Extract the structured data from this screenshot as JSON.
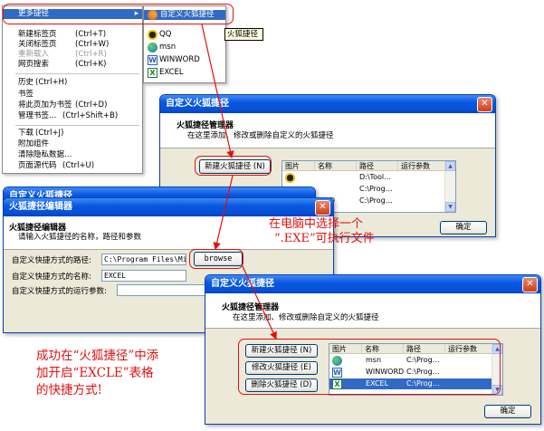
{
  "context_menu": {
    "items": [
      {
        "label": "更多捷径",
        "shortcut": "",
        "state": "highlighted"
      },
      {
        "label": "新建标签页",
        "shortcut": "(Ctrl+T)",
        "state": "normal"
      },
      {
        "label": "关闭标签页",
        "shortcut": "(Ctrl+W)",
        "state": "normal"
      },
      {
        "label": "重新载入",
        "shortcut": "(Ctrl+R)",
        "state": "disabled"
      },
      {
        "label": "网页搜索",
        "shortcut": "(Ctrl+K)",
        "state": "normal"
      },
      {
        "label": "历史",
        "shortcut": "(Ctrl+H)",
        "state": "normal"
      },
      {
        "label": "书签",
        "shortcut": "",
        "state": "normal"
      },
      {
        "label": "将此页加为书签",
        "shortcut": "(Ctrl+D)",
        "state": "normal"
      },
      {
        "label": "管理书签…",
        "shortcut": "(Ctrl+Shift+B)",
        "state": "normal"
      },
      {
        "label": "下载",
        "shortcut": "(Ctrl+J)",
        "state": "normal"
      },
      {
        "label": "附加组件",
        "shortcut": "",
        "state": "normal"
      },
      {
        "label": "清除隐私数据…",
        "shortcut": "",
        "state": "normal"
      },
      {
        "label": "页面源代码",
        "shortcut": "(Ctrl+U)",
        "state": "normal"
      }
    ]
  },
  "submenu": {
    "items": [
      "自定义火狐捷径",
      "QQ",
      "msn",
      "WINWORD",
      "EXCEL"
    ]
  },
  "tooltip": "火狐捷径",
  "manager_window_1": {
    "title": "自定义火狐捷径",
    "header_title": "火狐捷径管理器",
    "header_desc": "在这里添加、修改或删除自定义的火狐捷径",
    "new_button": "新建火狐捷径 (N)",
    "columns": [
      "图片",
      "名称",
      "路径",
      "运行参数"
    ],
    "rows": [
      {
        "name": "",
        "path": "D:\\Tool…"
      },
      {
        "name": "",
        "path": "C:\\Prog…"
      },
      {
        "name": "ORD",
        "path": "C:\\Prog…"
      }
    ],
    "ok_button": "确定"
  },
  "editor_window": {
    "title_behind": "自定义火狐捷径",
    "title": "火狐捷径编辑器",
    "header_title": "火狐捷径编辑器",
    "header_desc": "请输入火狐捷径的名称，路径和参数",
    "path_label": "自定义快捷方式的路径:",
    "path_value": "C:\\Program Files\\Micr",
    "browse_button": "browse",
    "name_label": "自定义快捷方式的名称:",
    "name_value": "EXCEL",
    "args_label": "自定义快捷方式的运行参数:",
    "args_value": ""
  },
  "manager_window_2": {
    "title": "自定义火狐捷径",
    "header_title": "火狐捷径管理器",
    "header_desc": "在这里添加、修改或删除自定义的火狐捷径",
    "new_button": "新建火狐捷径 (N)",
    "edit_button": "修改火狐捷径 (E)",
    "delete_button": "删除火狐捷径 (D)",
    "columns": [
      "图片",
      "名称",
      "路径",
      "运行参数"
    ],
    "rows": [
      {
        "name": "msn",
        "path": "C:\\Prog…"
      },
      {
        "name": "WINWORD",
        "path": "C:\\Prog…"
      },
      {
        "name": "EXCEL",
        "path": "C:\\Prog…"
      }
    ],
    "ok_button": "确定"
  },
  "annotations": {
    "choose_exe_line1": "在电脑中选择一个",
    "choose_exe_line2": "“.EXE”可执行文件",
    "success_line1": "成功在“火狐捷径”中添",
    "success_line2": "加开启“EXCLE”表格",
    "success_line3": "的快捷方式!"
  },
  "colors": {
    "annotation_red": "#e01010",
    "xp_title_blue": "#0551d8",
    "selection_blue": "#316ac5"
  }
}
